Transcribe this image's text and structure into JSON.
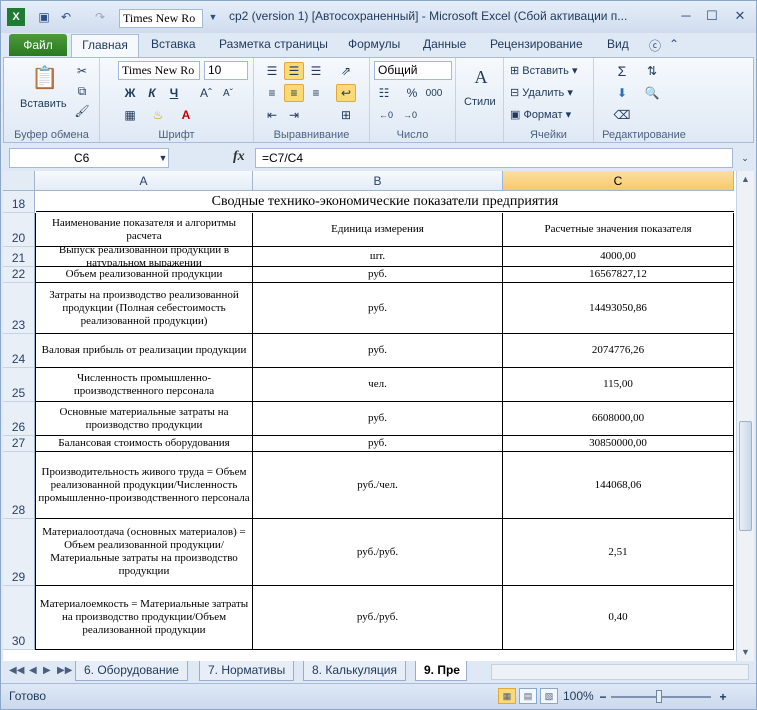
{
  "window": {
    "title": "cp2 (version 1) [Автосохраненный]  -  Microsoft Excel (Сбой активации п...",
    "font_name": "Times New Ro",
    "controls": [
      "minimize",
      "maximize",
      "close"
    ]
  },
  "ribbon_tabs": [
    "Файл",
    "Главная",
    "Вставка",
    "Разметка страницы",
    "Формулы",
    "Данные",
    "Рецензирование",
    "Вид"
  ],
  "ribbon": {
    "clipboard": {
      "paste": "Вставить",
      "label": "Буфер обмена"
    },
    "font": {
      "name": "Times New Ro",
      "size": "10",
      "bold": "Ж",
      "italic": "К",
      "underline": "Ч",
      "label": "Шрифт"
    },
    "alignment": {
      "label": "Выравнивание"
    },
    "number": {
      "format": "Общий",
      "percent": "%",
      "thousands": "000",
      "label": "Число"
    },
    "styles": {
      "button": "Стили"
    },
    "cells": {
      "insert": "Вставить",
      "delete": "Удалить",
      "format": "Формат",
      "label": "Ячейки"
    },
    "editing": {
      "label": "Редактирование"
    }
  },
  "formula_bar": {
    "name_box": "C6",
    "fx": "fx",
    "formula": "=C7/C4"
  },
  "columns": [
    "A",
    "B",
    "C"
  ],
  "sheet_title": "Сводные технико-экономические показатели предприятия",
  "title_row": "18",
  "rows": [
    {
      "n": "20",
      "a": "Наименование показателя и алгоритмы расчета",
      "b": "Единица измерения",
      "c": "Расчетные значения показателя"
    },
    {
      "n": "21",
      "a": "Выпуск  реализованной продукции в натуральном выражении",
      "b": "шт.",
      "c": "4000,00"
    },
    {
      "n": "22",
      "a": "Объем реализованной продукции",
      "b": "руб.",
      "c": "16567827,12"
    },
    {
      "n": "23",
      "a": "Затраты на производство реализованной продукции (Полная себестоимость реализованной продукции)",
      "b": "руб.",
      "c": "14493050,86"
    },
    {
      "n": "24",
      "a": "Валовая прибыль от реализации продукции",
      "b": "руб.",
      "c": "2074776,26"
    },
    {
      "n": "25",
      "a": "Численность промышленно-производственного персонала",
      "b": "чел.",
      "c": "115,00"
    },
    {
      "n": "26",
      "a": "Основные материальные затраты на производство продукции",
      "b": "руб.",
      "c": "6608000,00"
    },
    {
      "n": "27",
      "a": "Балансовая стоимость оборудования",
      "b": "руб.",
      "c": "30850000,00"
    },
    {
      "n": "28",
      "a": "Производительность живого труда = Объем реализованной продукции/Численность промышленно-производственного персонала",
      "b": "руб./чел.",
      "c": "144068,06"
    },
    {
      "n": "29",
      "a": "Материалоотдача (основных материалов) = Объем реализованной продукции/Материальные затраты на производство продукции",
      "b": "руб./руб.",
      "c": "2,51"
    },
    {
      "n": "30",
      "a": "Материалоемкость = Материальные затраты на производство продукции/Объем реализованной продукции",
      "b": "руб./руб.",
      "c": "0,40"
    }
  ],
  "sheet_tabs": [
    "6. Оборудование",
    "7. Нормативы",
    "8. Калькуляция",
    "9. Пре"
  ],
  "status": {
    "ready": "Готово",
    "zoom": "100%"
  }
}
